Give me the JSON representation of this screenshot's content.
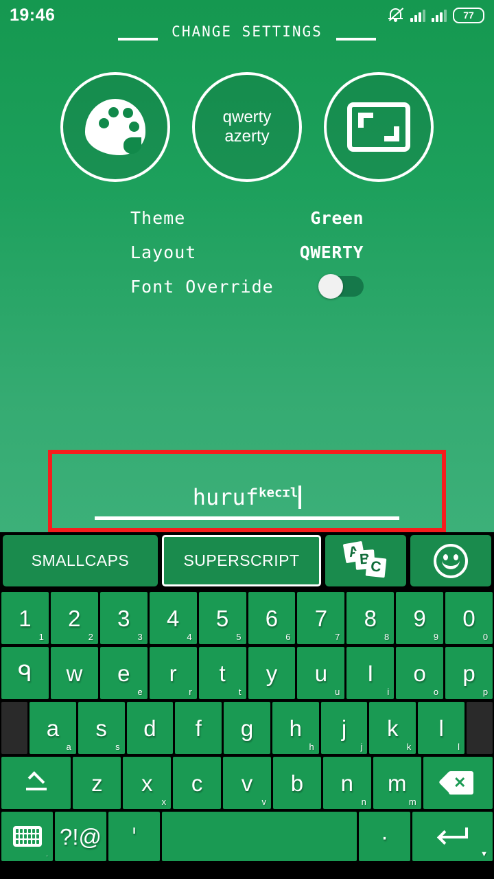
{
  "status_bar": {
    "clock": "19:46",
    "battery_level": "77",
    "silent_icon": "bell-slash-icon",
    "signal_icon": "signal-bars-icon"
  },
  "app": {
    "header_title": "CHANGE SETTINGS",
    "circles": [
      {
        "name": "theme-button",
        "icon": "palette-icon",
        "label": ""
      },
      {
        "name": "layout-button",
        "icon": "",
        "label": "qwerty\nazerty",
        "line1": "qwerty",
        "line2": "azerty"
      },
      {
        "name": "font-size-button",
        "icon": "resize-icon",
        "label": ""
      }
    ],
    "settings": [
      {
        "key": "Theme",
        "value": "Green",
        "type": "text"
      },
      {
        "key": "Layout",
        "value": "QWERTY",
        "type": "text"
      },
      {
        "key": "Font Override",
        "value": "off",
        "type": "toggle"
      }
    ],
    "text_field": {
      "base_text": "huruf",
      "superscript_text": "kecɪl",
      "full_value": "hurufkecɪl",
      "caret": "|"
    },
    "highlight_color": "#f61d1d"
  },
  "keyboard": {
    "strip": [
      {
        "label": "SMALLCAPS",
        "selected": false,
        "name": "smallcaps-button"
      },
      {
        "label": "SUPERSCRIPT",
        "selected": true,
        "name": "superscript-button"
      },
      {
        "label": "",
        "icon": "abc-icon",
        "selected": false,
        "name": "abc-case-button"
      },
      {
        "label": "",
        "icon": "emoji-icon",
        "selected": false,
        "name": "emoji-button"
      }
    ],
    "rows": {
      "numbers": [
        {
          "main": "1",
          "hint": "1"
        },
        {
          "main": "2",
          "hint": "2"
        },
        {
          "main": "3",
          "hint": "3"
        },
        {
          "main": "4",
          "hint": "4"
        },
        {
          "main": "5",
          "hint": "5"
        },
        {
          "main": "6",
          "hint": "6"
        },
        {
          "main": "7",
          "hint": "7"
        },
        {
          "main": "8",
          "hint": "8"
        },
        {
          "main": "9",
          "hint": "9"
        },
        {
          "main": "0",
          "hint": "0"
        }
      ],
      "top": [
        {
          "main": "ᑫ",
          "hint": ""
        },
        {
          "main": "w",
          "hint": ""
        },
        {
          "main": "e",
          "hint": "e"
        },
        {
          "main": "r",
          "hint": "r"
        },
        {
          "main": "t",
          "hint": "t"
        },
        {
          "main": "y",
          "hint": ""
        },
        {
          "main": "u",
          "hint": "u"
        },
        {
          "main": "I",
          "hint": "i"
        },
        {
          "main": "o",
          "hint": "o"
        },
        {
          "main": "p",
          "hint": "p"
        }
      ],
      "home": [
        {
          "main": "a",
          "hint": "a"
        },
        {
          "main": "s",
          "hint": "s"
        },
        {
          "main": "d",
          "hint": ""
        },
        {
          "main": "f",
          "hint": ""
        },
        {
          "main": "g",
          "hint": ""
        },
        {
          "main": "h",
          "hint": "h"
        },
        {
          "main": "j",
          "hint": "j"
        },
        {
          "main": "k",
          "hint": "k"
        },
        {
          "main": "l",
          "hint": "l"
        }
      ],
      "bottom": [
        {
          "main": "z",
          "hint": ""
        },
        {
          "main": "x",
          "hint": "x"
        },
        {
          "main": "c",
          "hint": ""
        },
        {
          "main": "v",
          "hint": "v"
        },
        {
          "main": "b",
          "hint": ""
        },
        {
          "main": "n",
          "hint": "n"
        },
        {
          "main": "m",
          "hint": "m"
        }
      ],
      "space_row": {
        "switch_keyboard": {
          "icon": "keyboard-icon",
          "hint": "."
        },
        "symbols": {
          "label": "?!@"
        },
        "apostrophe": {
          "label": "ˈ"
        },
        "space": {
          "label": ""
        },
        "period": {
          "label": "·"
        },
        "enter": {
          "icon": "enter-icon",
          "hint": "▼"
        }
      },
      "shift": {
        "icon": "shift-icon"
      },
      "backspace": {
        "icon": "backspace-icon"
      }
    },
    "colors": {
      "key": "#1a9a53",
      "background": "#000000",
      "filler": "#2a2a2a",
      "chip": "#1a8b4d"
    }
  }
}
